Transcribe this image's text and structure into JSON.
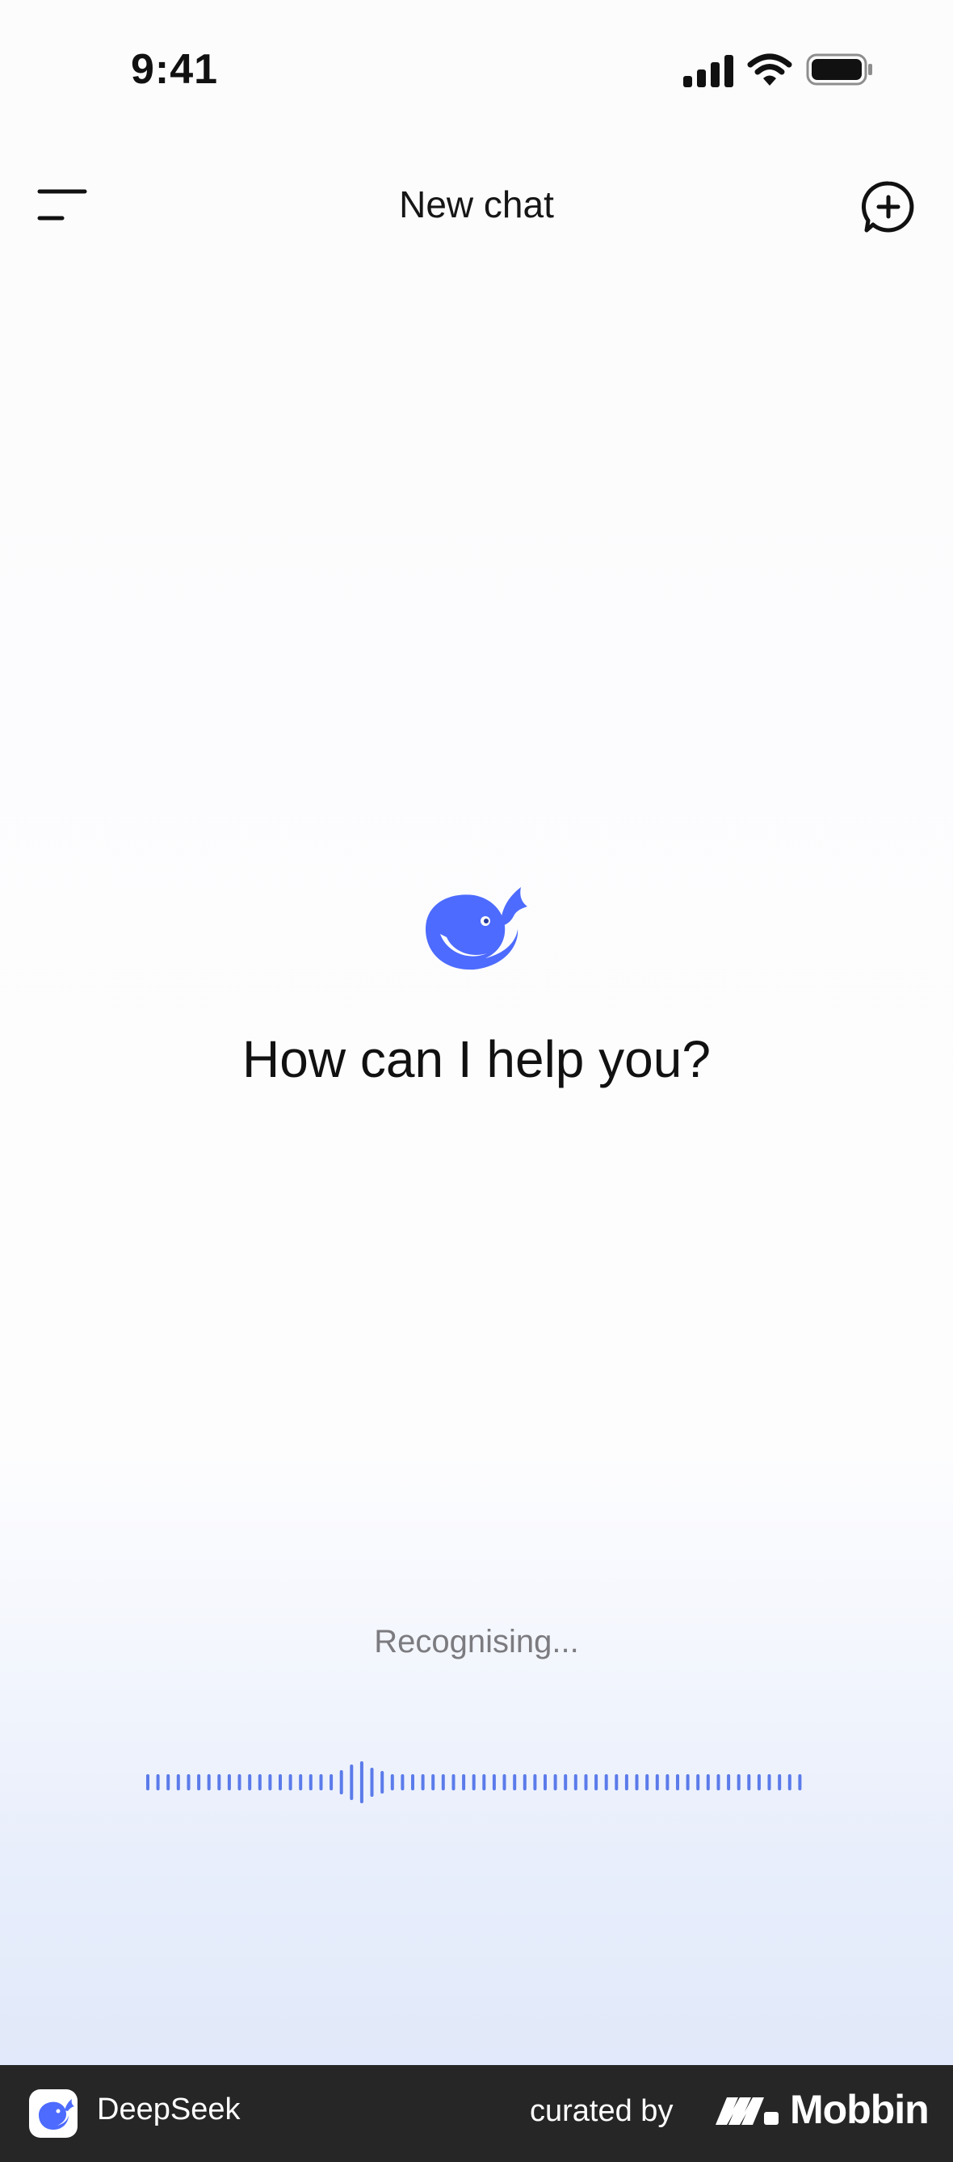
{
  "status_bar": {
    "time": "9:41",
    "icons": [
      "signal-icon",
      "wifi-icon",
      "battery-icon"
    ]
  },
  "header": {
    "title": "New chat",
    "menu_icon": "menu-icon",
    "new_chat_icon": "new-chat-icon"
  },
  "main": {
    "logo_icon": "whale-logo-icon",
    "greeting": "How can I help you?"
  },
  "voice": {
    "status": "Recognising..."
  },
  "brand_bar": {
    "app_name": "DeepSeek",
    "curated_by": "curated by",
    "mobbin": "Mobbin"
  },
  "colors": {
    "accent": "#4D6BFE",
    "waveform": "#5B7BEA",
    "text_primary": "#111111",
    "text_secondary": "#7B7B80",
    "brand_bar_bg": "#262626"
  }
}
